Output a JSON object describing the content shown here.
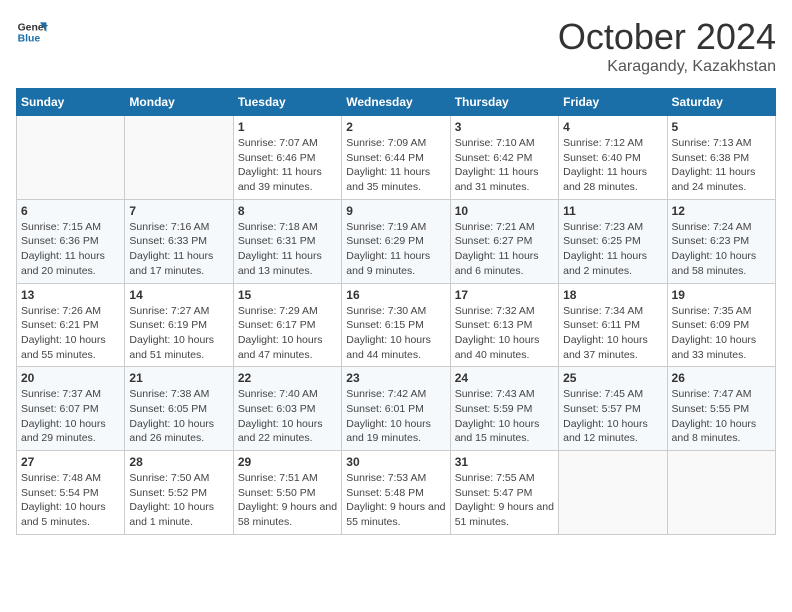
{
  "logo": {
    "text_general": "General",
    "text_blue": "Blue"
  },
  "header": {
    "month": "October 2024",
    "location": "Karagandy, Kazakhstan"
  },
  "weekdays": [
    "Sunday",
    "Monday",
    "Tuesday",
    "Wednesday",
    "Thursday",
    "Friday",
    "Saturday"
  ],
  "weeks": [
    [
      null,
      null,
      {
        "day": "1",
        "sunrise": "Sunrise: 7:07 AM",
        "sunset": "Sunset: 6:46 PM",
        "daylight": "Daylight: 11 hours and 39 minutes."
      },
      {
        "day": "2",
        "sunrise": "Sunrise: 7:09 AM",
        "sunset": "Sunset: 6:44 PM",
        "daylight": "Daylight: 11 hours and 35 minutes."
      },
      {
        "day": "3",
        "sunrise": "Sunrise: 7:10 AM",
        "sunset": "Sunset: 6:42 PM",
        "daylight": "Daylight: 11 hours and 31 minutes."
      },
      {
        "day": "4",
        "sunrise": "Sunrise: 7:12 AM",
        "sunset": "Sunset: 6:40 PM",
        "daylight": "Daylight: 11 hours and 28 minutes."
      },
      {
        "day": "5",
        "sunrise": "Sunrise: 7:13 AM",
        "sunset": "Sunset: 6:38 PM",
        "daylight": "Daylight: 11 hours and 24 minutes."
      }
    ],
    [
      {
        "day": "6",
        "sunrise": "Sunrise: 7:15 AM",
        "sunset": "Sunset: 6:36 PM",
        "daylight": "Daylight: 11 hours and 20 minutes."
      },
      {
        "day": "7",
        "sunrise": "Sunrise: 7:16 AM",
        "sunset": "Sunset: 6:33 PM",
        "daylight": "Daylight: 11 hours and 17 minutes."
      },
      {
        "day": "8",
        "sunrise": "Sunrise: 7:18 AM",
        "sunset": "Sunset: 6:31 PM",
        "daylight": "Daylight: 11 hours and 13 minutes."
      },
      {
        "day": "9",
        "sunrise": "Sunrise: 7:19 AM",
        "sunset": "Sunset: 6:29 PM",
        "daylight": "Daylight: 11 hours and 9 minutes."
      },
      {
        "day": "10",
        "sunrise": "Sunrise: 7:21 AM",
        "sunset": "Sunset: 6:27 PM",
        "daylight": "Daylight: 11 hours and 6 minutes."
      },
      {
        "day": "11",
        "sunrise": "Sunrise: 7:23 AM",
        "sunset": "Sunset: 6:25 PM",
        "daylight": "Daylight: 11 hours and 2 minutes."
      },
      {
        "day": "12",
        "sunrise": "Sunrise: 7:24 AM",
        "sunset": "Sunset: 6:23 PM",
        "daylight": "Daylight: 10 hours and 58 minutes."
      }
    ],
    [
      {
        "day": "13",
        "sunrise": "Sunrise: 7:26 AM",
        "sunset": "Sunset: 6:21 PM",
        "daylight": "Daylight: 10 hours and 55 minutes."
      },
      {
        "day": "14",
        "sunrise": "Sunrise: 7:27 AM",
        "sunset": "Sunset: 6:19 PM",
        "daylight": "Daylight: 10 hours and 51 minutes."
      },
      {
        "day": "15",
        "sunrise": "Sunrise: 7:29 AM",
        "sunset": "Sunset: 6:17 PM",
        "daylight": "Daylight: 10 hours and 47 minutes."
      },
      {
        "day": "16",
        "sunrise": "Sunrise: 7:30 AM",
        "sunset": "Sunset: 6:15 PM",
        "daylight": "Daylight: 10 hours and 44 minutes."
      },
      {
        "day": "17",
        "sunrise": "Sunrise: 7:32 AM",
        "sunset": "Sunset: 6:13 PM",
        "daylight": "Daylight: 10 hours and 40 minutes."
      },
      {
        "day": "18",
        "sunrise": "Sunrise: 7:34 AM",
        "sunset": "Sunset: 6:11 PM",
        "daylight": "Daylight: 10 hours and 37 minutes."
      },
      {
        "day": "19",
        "sunrise": "Sunrise: 7:35 AM",
        "sunset": "Sunset: 6:09 PM",
        "daylight": "Daylight: 10 hours and 33 minutes."
      }
    ],
    [
      {
        "day": "20",
        "sunrise": "Sunrise: 7:37 AM",
        "sunset": "Sunset: 6:07 PM",
        "daylight": "Daylight: 10 hours and 29 minutes."
      },
      {
        "day": "21",
        "sunrise": "Sunrise: 7:38 AM",
        "sunset": "Sunset: 6:05 PM",
        "daylight": "Daylight: 10 hours and 26 minutes."
      },
      {
        "day": "22",
        "sunrise": "Sunrise: 7:40 AM",
        "sunset": "Sunset: 6:03 PM",
        "daylight": "Daylight: 10 hours and 22 minutes."
      },
      {
        "day": "23",
        "sunrise": "Sunrise: 7:42 AM",
        "sunset": "Sunset: 6:01 PM",
        "daylight": "Daylight: 10 hours and 19 minutes."
      },
      {
        "day": "24",
        "sunrise": "Sunrise: 7:43 AM",
        "sunset": "Sunset: 5:59 PM",
        "daylight": "Daylight: 10 hours and 15 minutes."
      },
      {
        "day": "25",
        "sunrise": "Sunrise: 7:45 AM",
        "sunset": "Sunset: 5:57 PM",
        "daylight": "Daylight: 10 hours and 12 minutes."
      },
      {
        "day": "26",
        "sunrise": "Sunrise: 7:47 AM",
        "sunset": "Sunset: 5:55 PM",
        "daylight": "Daylight: 10 hours and 8 minutes."
      }
    ],
    [
      {
        "day": "27",
        "sunrise": "Sunrise: 7:48 AM",
        "sunset": "Sunset: 5:54 PM",
        "daylight": "Daylight: 10 hours and 5 minutes."
      },
      {
        "day": "28",
        "sunrise": "Sunrise: 7:50 AM",
        "sunset": "Sunset: 5:52 PM",
        "daylight": "Daylight: 10 hours and 1 minute."
      },
      {
        "day": "29",
        "sunrise": "Sunrise: 7:51 AM",
        "sunset": "Sunset: 5:50 PM",
        "daylight": "Daylight: 9 hours and 58 minutes."
      },
      {
        "day": "30",
        "sunrise": "Sunrise: 7:53 AM",
        "sunset": "Sunset: 5:48 PM",
        "daylight": "Daylight: 9 hours and 55 minutes."
      },
      {
        "day": "31",
        "sunrise": "Sunrise: 7:55 AM",
        "sunset": "Sunset: 5:47 PM",
        "daylight": "Daylight: 9 hours and 51 minutes."
      },
      null,
      null
    ]
  ]
}
